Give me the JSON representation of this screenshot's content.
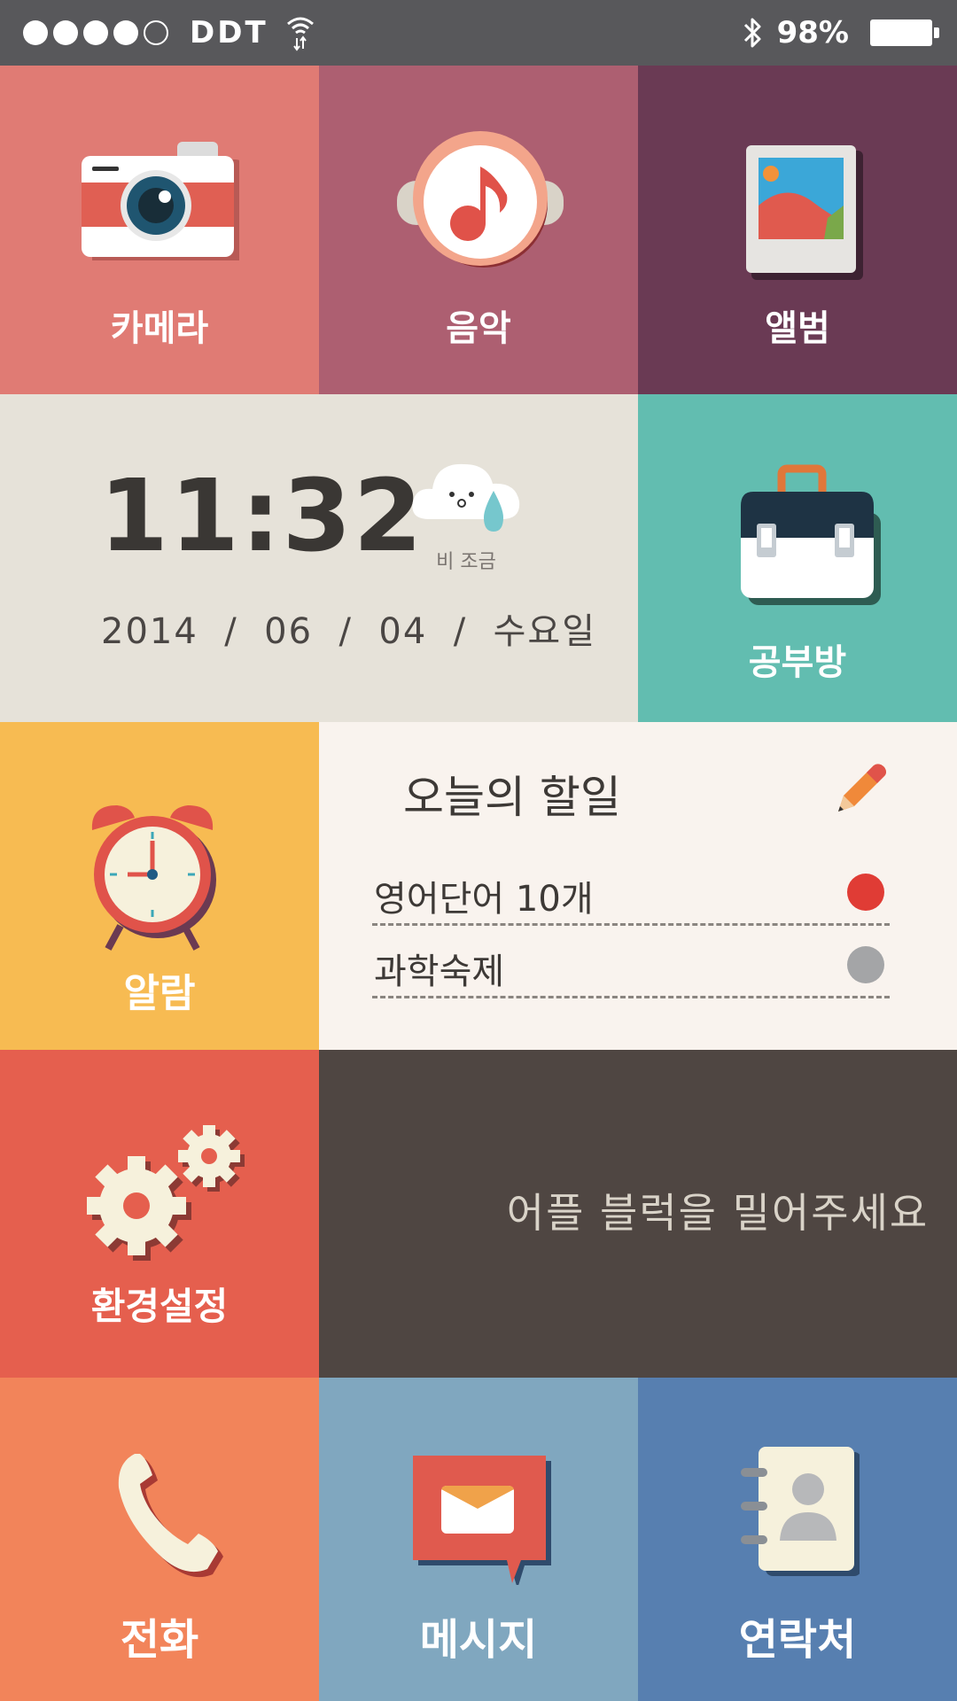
{
  "status_bar": {
    "signal_dots": [
      true,
      true,
      true,
      true,
      false
    ],
    "carrier": "DDT",
    "battery_percent": "98%"
  },
  "tiles": {
    "camera": {
      "label": "카메라",
      "color": "#e07b74"
    },
    "music": {
      "label": "음악",
      "color": "#ad5f71"
    },
    "album": {
      "label": "앨범",
      "color": "#6a3a54"
    },
    "clock": {
      "time": "11:32",
      "date": "2014  /  06  /  04  /  수요일",
      "weather": "비 조금",
      "color": "#e6e2d9"
    },
    "study": {
      "label": "공부방",
      "color": "#62bdb0"
    },
    "alarm": {
      "label": "알람",
      "color": "#f7bb52"
    },
    "settings": {
      "label": "환경설정",
      "color": "#e55f4e"
    },
    "promo": {
      "text": "어플 블럭을 밀어주세요",
      "color": "#4f4642"
    },
    "phone": {
      "label": "전화",
      "color": "#f2845a"
    },
    "message": {
      "label": "메시지",
      "color": "#80a7bf"
    },
    "contacts": {
      "label": "연락처",
      "color": "#577fb0"
    }
  },
  "todo": {
    "title": "오늘의 할일",
    "items": [
      {
        "text": "영어단어 10개",
        "status_color": "#e03c35"
      },
      {
        "text": "과학숙제",
        "status_color": "#a4a5a7"
      }
    ]
  }
}
